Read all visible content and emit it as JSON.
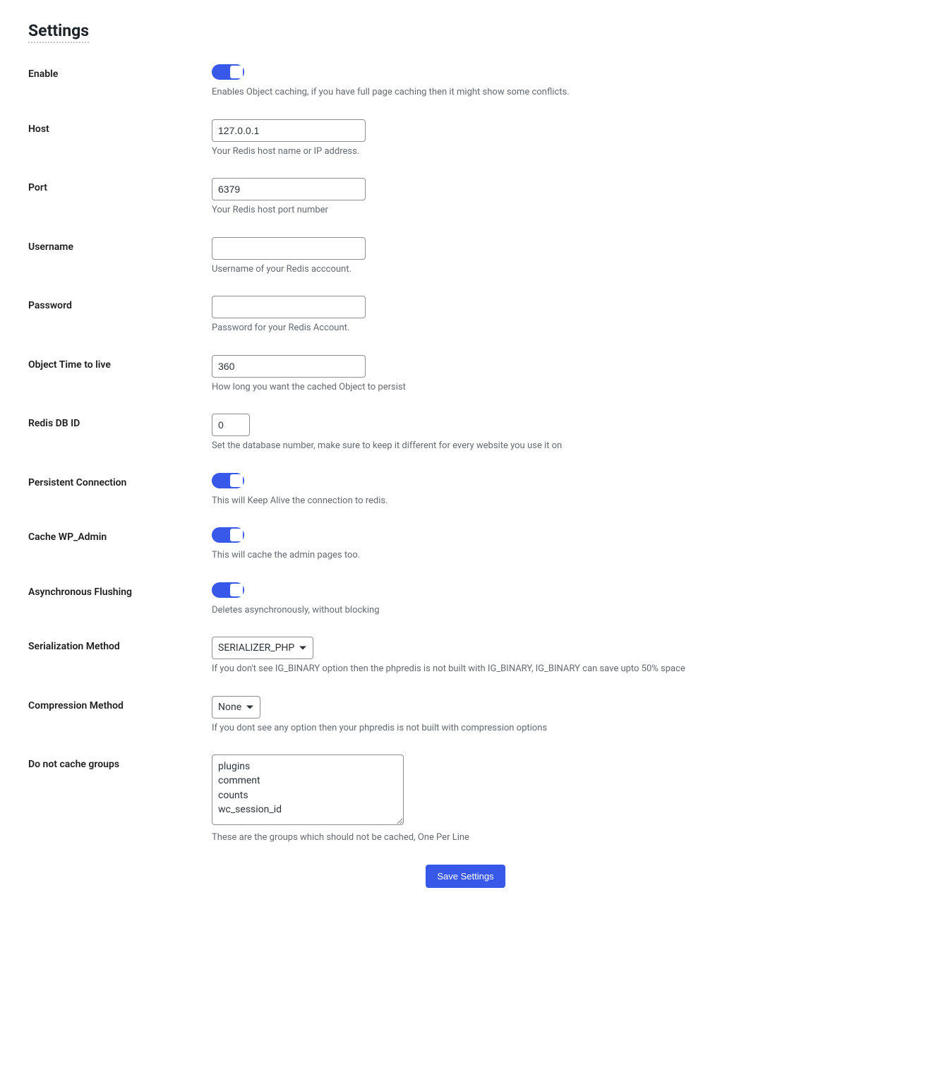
{
  "page": {
    "title": "Settings"
  },
  "fields": {
    "enable": {
      "label": "Enable",
      "description": "Enables Object caching, if you have full page caching then it might show some conflicts."
    },
    "host": {
      "label": "Host",
      "value": "127.0.0.1",
      "description": "Your Redis host name or IP address."
    },
    "port": {
      "label": "Port",
      "value": "6379",
      "description": "Your Redis host port number"
    },
    "username": {
      "label": "Username",
      "value": "",
      "description": "Username of your Redis acccount."
    },
    "password": {
      "label": "Password",
      "value": "",
      "description": "Password for your Redis Account."
    },
    "ttl": {
      "label": "Object Time to live",
      "value": "360",
      "description": "How long you want the cached Object to persist"
    },
    "db_id": {
      "label": "Redis DB ID",
      "value": "0",
      "description": "Set the database number, make sure to keep it different for every website you use it on"
    },
    "persistent": {
      "label": "Persistent Connection",
      "description": "This will Keep Alive the connection to redis."
    },
    "cache_wp_admin": {
      "label": "Cache WP_Admin",
      "description": "This will cache the admin pages too."
    },
    "async_flush": {
      "label": "Asynchronous Flushing",
      "description": "Deletes asynchronously, without blocking"
    },
    "serialization": {
      "label": "Serialization Method",
      "value": "SERIALIZER_PHP",
      "description": "If you don't see IG_BINARY option then the phpredis is not built with IG_BINARY, IG_BINARY can save upto 50% space"
    },
    "compression": {
      "label": "Compression Method",
      "value": "None",
      "description": "If you dont see any option then your phpredis is not built with compression options"
    },
    "no_cache_groups": {
      "label": "Do not cache groups",
      "value": "plugins\ncomment\ncounts\nwc_session_id",
      "description": "These are the groups which should not be cached, One Per Line"
    }
  },
  "actions": {
    "save": "Save Settings"
  }
}
